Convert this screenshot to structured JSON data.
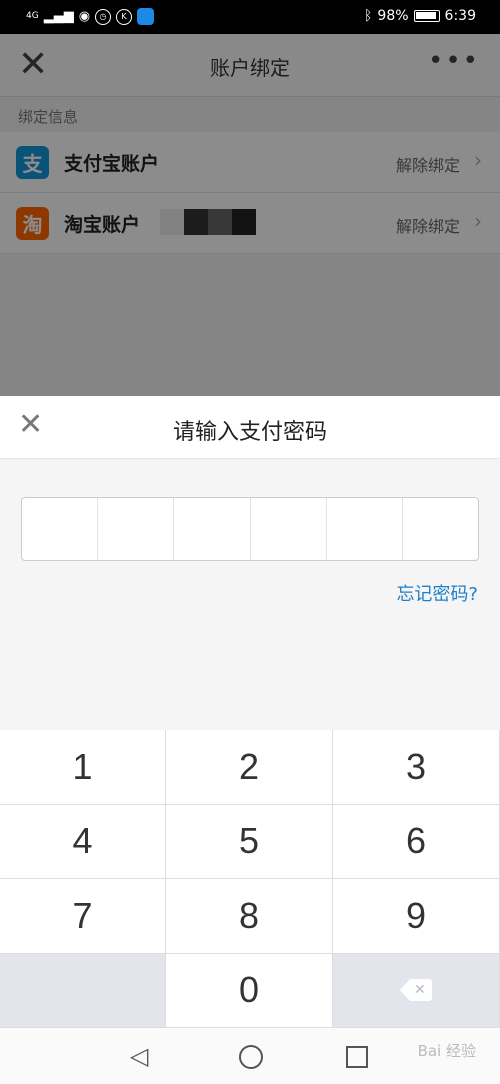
{
  "status_bar": {
    "signal": "4G",
    "battery": "98%",
    "time": "6:39",
    "icons": [
      "signal-icon",
      "eye-icon",
      "alarm-icon",
      "k-icon",
      "app-icon",
      "bluetooth-icon",
      "battery-icon"
    ]
  },
  "header": {
    "title": "账户绑定",
    "close_icon": "close-icon",
    "more_icon": "more-icon"
  },
  "bindings": {
    "section_label": "绑定信息",
    "rows": [
      {
        "icon_text": "支",
        "name": "支付宝账户",
        "action": "解除绑定"
      },
      {
        "icon_text": "淘",
        "name": "淘宝账户",
        "action": "解除绑定"
      }
    ]
  },
  "password_sheet": {
    "title": "请输入支付密码",
    "forgot": "忘记密码?",
    "digits": 6
  },
  "keypad": {
    "keys": [
      "1",
      "2",
      "3",
      "4",
      "5",
      "6",
      "7",
      "8",
      "9",
      "",
      "0",
      ""
    ]
  },
  "watermark": "Bai 经验"
}
